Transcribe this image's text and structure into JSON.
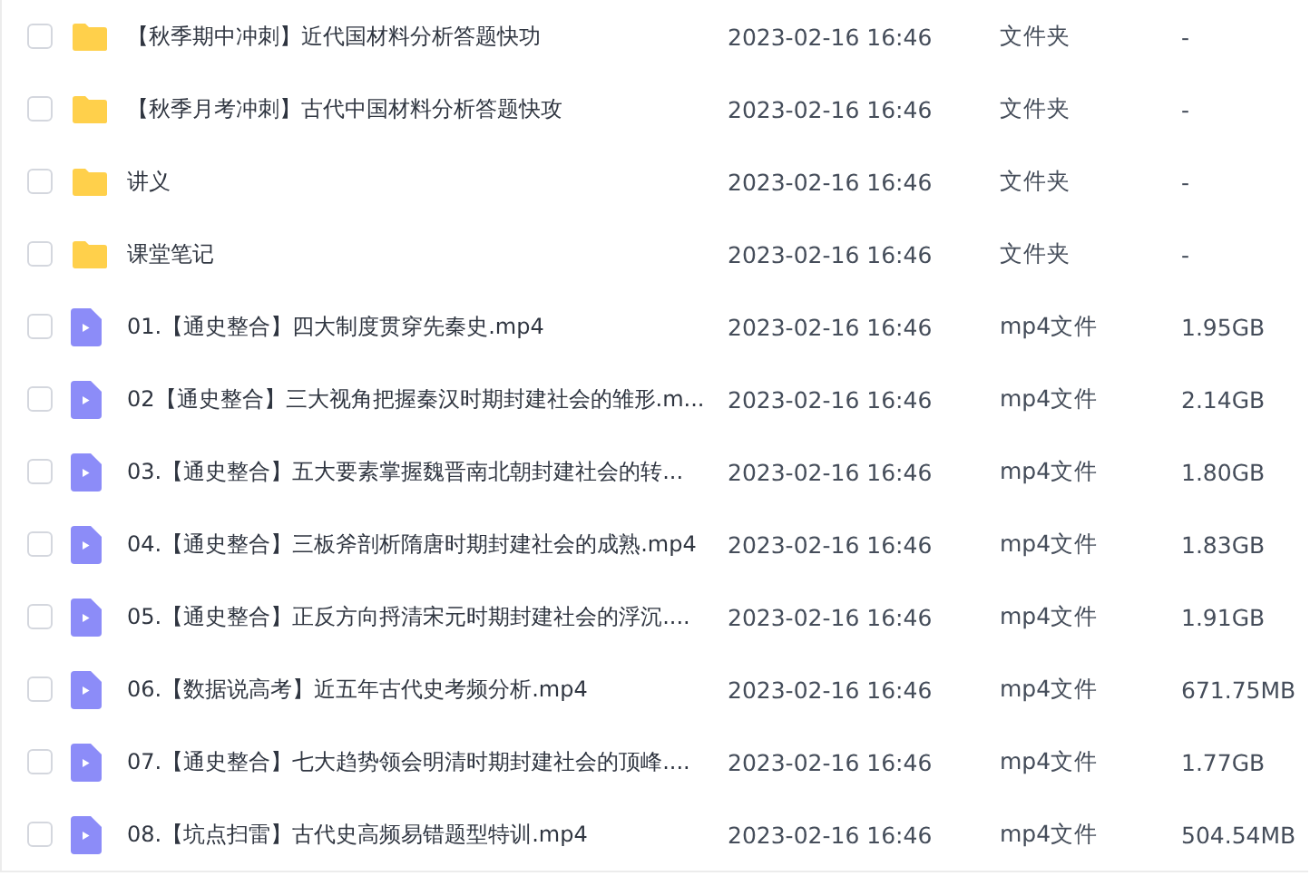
{
  "files": [
    {
      "kind": "folder",
      "name": "【秋季期中冲刺】近代国材料分析答题快功",
      "modified": "2023-02-16 16:46",
      "type": "文件夹",
      "size": "-",
      "checked": false
    },
    {
      "kind": "folder",
      "name": "【秋季月考冲刺】古代中国材料分析答题快攻",
      "modified": "2023-02-16 16:46",
      "type": "文件夹",
      "size": "-",
      "checked": false
    },
    {
      "kind": "folder",
      "name": "讲义",
      "modified": "2023-02-16 16:46",
      "type": "文件夹",
      "size": "-",
      "checked": false
    },
    {
      "kind": "folder",
      "name": "课堂笔记",
      "modified": "2023-02-16 16:46",
      "type": "文件夹",
      "size": "-",
      "checked": false
    },
    {
      "kind": "video",
      "name": "01.【通史整合】四大制度贯穿先秦史.mp4",
      "modified": "2023-02-16 16:46",
      "type": "mp4文件",
      "size": "1.95GB",
      "checked": false
    },
    {
      "kind": "video",
      "name": "02【通史整合】三大视角把握秦汉时期封建社会的雏形.m...",
      "modified": "2023-02-16 16:46",
      "type": "mp4文件",
      "size": "2.14GB",
      "checked": false
    },
    {
      "kind": "video",
      "name": "03.【通史整合】五大要素掌握魏晋南北朝封建社会的转...",
      "modified": "2023-02-16 16:46",
      "type": "mp4文件",
      "size": "1.80GB",
      "checked": false
    },
    {
      "kind": "video",
      "name": "04.【通史整合】三板斧剖析隋唐时期封建社会的成熟.mp4",
      "modified": "2023-02-16 16:46",
      "type": "mp4文件",
      "size": "1.83GB",
      "checked": false
    },
    {
      "kind": "video",
      "name": "05.【通史整合】正反方向捋清宋元时期封建社会的浮沉....",
      "modified": "2023-02-16 16:46",
      "type": "mp4文件",
      "size": "1.91GB",
      "checked": false
    },
    {
      "kind": "video",
      "name": "06.【数据说高考】近五年古代史考频分析.mp4",
      "modified": "2023-02-16 16:46",
      "type": "mp4文件",
      "size": "671.75MB",
      "checked": false
    },
    {
      "kind": "video",
      "name": "07.【通史整合】七大趋势领会明清时期封建社会的顶峰....",
      "modified": "2023-02-16 16:46",
      "type": "mp4文件",
      "size": "1.77GB",
      "checked": false
    },
    {
      "kind": "video",
      "name": "08.【坑点扫雷】古代史高频易错题型特训.mp4",
      "modified": "2023-02-16 16:46",
      "type": "mp4文件",
      "size": "504.54MB",
      "checked": false
    }
  ]
}
